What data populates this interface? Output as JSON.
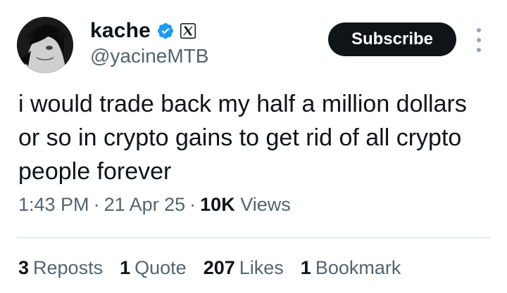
{
  "author": {
    "display_name": "kache",
    "handle": "@yacineMTB",
    "verified": true,
    "affiliate_badge": "x-logo-icon",
    "avatar": "anime-character-avatar"
  },
  "header": {
    "subscribe_label": "Subscribe",
    "more_icon": "more-vertical-icon"
  },
  "tweet": {
    "text": "i would trade back my half a million dollars or so in crypto gains to get rid of all crypto people forever",
    "time": "1:43 PM",
    "date": "21 Apr 25",
    "views_count": "10K",
    "views_label": "Views",
    "separator": "·"
  },
  "stats": {
    "reposts_count": "3",
    "reposts_label": "Reposts",
    "quotes_count": "1",
    "quotes_label": "Quote",
    "likes_count": "207",
    "likes_label": "Likes",
    "bookmarks_count": "1",
    "bookmarks_label": "Bookmark"
  },
  "colors": {
    "text_primary": "#0f1419",
    "text_secondary": "#536471",
    "verified_blue": "#1d9bf0",
    "button_bg": "#0f1419",
    "divider": "#cfd9de"
  }
}
